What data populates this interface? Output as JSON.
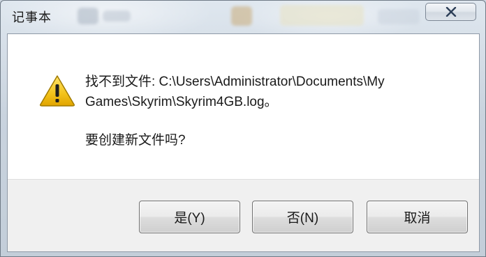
{
  "window": {
    "title": "记事本",
    "close_icon": "close-icon"
  },
  "dialog": {
    "icon": "warning-icon",
    "message_line1": "找不到文件: C:\\Users\\Administrator\\Documents\\My",
    "message_line2": "Games\\Skyrim\\Skyrim4GB.log。",
    "question": "要创建新文件吗?"
  },
  "buttons": {
    "yes_label": "是(Y)",
    "no_label": "否(N)",
    "cancel_label": "取消"
  },
  "colors": {
    "warning_yellow": "#f3c21a",
    "warning_outline": "#a07a00"
  }
}
